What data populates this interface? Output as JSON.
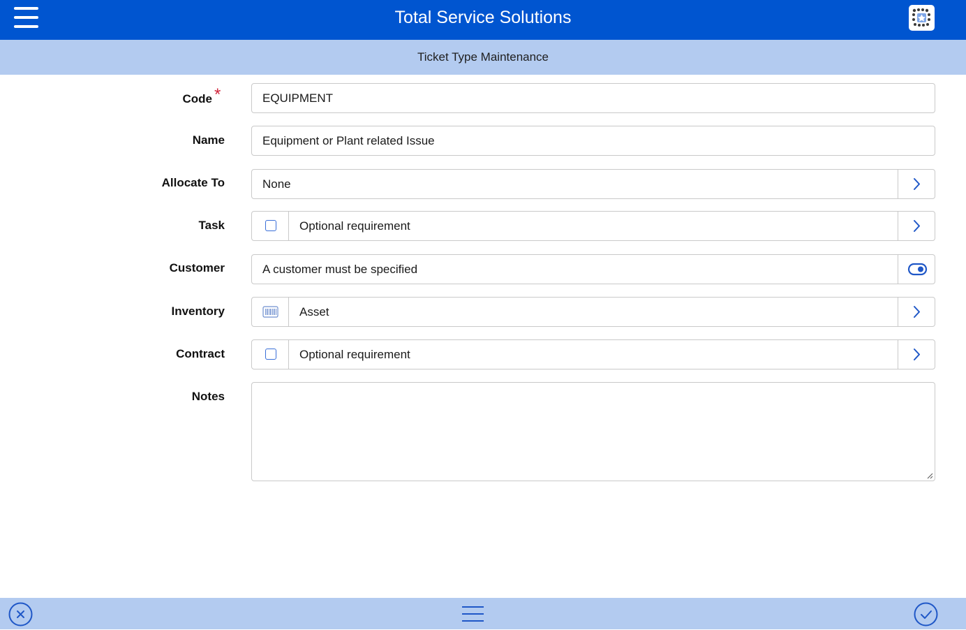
{
  "header": {
    "title": "Total Service Solutions"
  },
  "subheader": {
    "title": "Ticket Type Maintenance"
  },
  "form": {
    "code": {
      "label": "Code",
      "value": "EQUIPMENT",
      "required": true
    },
    "name": {
      "label": "Name",
      "value": "Equipment or Plant related Issue"
    },
    "allocate_to": {
      "label": "Allocate To",
      "value": "None"
    },
    "task": {
      "label": "Task",
      "value": "Optional requirement",
      "checked": false
    },
    "customer": {
      "label": "Customer",
      "value": "A customer must be specified",
      "toggle_on": true
    },
    "inventory": {
      "label": "Inventory",
      "value": "Asset"
    },
    "contract": {
      "label": "Contract",
      "value": "Optional requirement",
      "checked": false
    },
    "notes": {
      "label": "Notes",
      "value": ""
    }
  },
  "colors": {
    "primary": "#0055d0",
    "secondary_bar": "#b3cbf0",
    "accent": "#1f57c7",
    "required": "#d0253b"
  },
  "icons": {
    "menu": "hamburger-icon",
    "logo": "app-logo-icon",
    "chevron": "chevron-right-icon",
    "toggle": "toggle-on-icon",
    "barcode": "barcode-icon",
    "cancel": "close-circle-icon",
    "confirm": "check-circle-icon"
  }
}
